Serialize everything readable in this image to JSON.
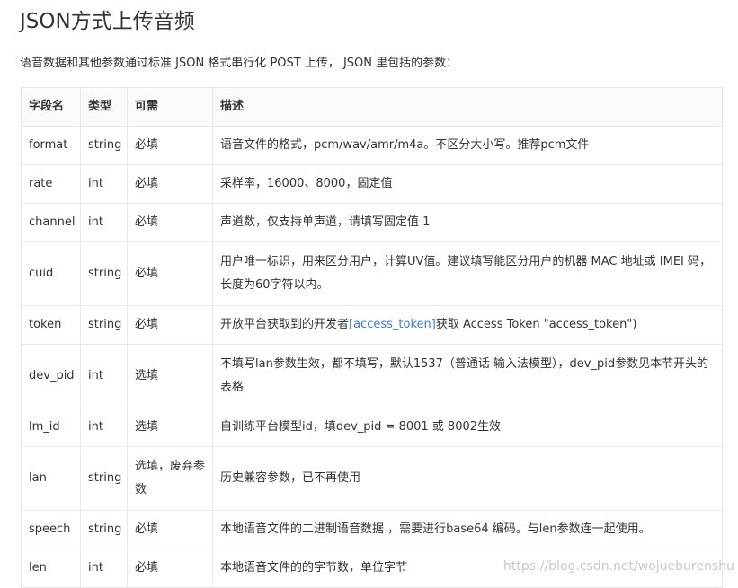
{
  "title": "JSON方式上传音频",
  "intro": "语音数据和其他参数通过标准 JSON 格式串行化 POST 上传， JSON 里包括的参数：",
  "table": {
    "headers": [
      "字段名",
      "类型",
      "可需",
      "描述"
    ],
    "rows": [
      {
        "name": "format",
        "type": "string",
        "required": "必填",
        "desc": "语音文件的格式，pcm/wav/amr/m4a。不区分大小写。推荐pcm文件"
      },
      {
        "name": "rate",
        "type": "int",
        "required": "必填",
        "desc": "采样率，16000、8000，固定值"
      },
      {
        "name": "channel",
        "type": "int",
        "required": "必填",
        "desc": "声道数，仅支持单声道，请填写固定值 1"
      },
      {
        "name": "cuid",
        "type": "string",
        "required": "必填",
        "desc": "用户唯一标识，用来区分用户，计算UV值。建议填写能区分用户的机器 MAC 地址或 IMEI 码，长度为60字符以内。"
      },
      {
        "name": "token",
        "type": "string",
        "required": "必填",
        "desc_pre": "开放平台获取到的开发者",
        "desc_link": "[access_token]",
        "desc_post": "获取 Access Token \"access_token\")"
      },
      {
        "name": "dev_pid",
        "type": "int",
        "required": "选填",
        "desc": "不填写lan参数生效，都不填写，默认1537（普通话 输入法模型），dev_pid参数见本节开头的表格"
      },
      {
        "name": "lm_id",
        "type": "int",
        "required": "选填",
        "desc": "自训练平台模型id，填dev_pid = 8001 或 8002生效"
      },
      {
        "name": "lan",
        "type": "string",
        "required": "选填，废弃参数",
        "desc": "历史兼容参数，已不再使用"
      },
      {
        "name": "speech",
        "type": "string",
        "required": "必填",
        "desc": "本地语音文件的二进制语音数据 ，需要进行base64 编码。与len参数连一起使用。"
      },
      {
        "name": "len",
        "type": "int",
        "required": "必填",
        "desc": "本地语音文件的的字节数，单位字节"
      }
    ]
  },
  "watermark": "https://blog.csdn.net/wojueburenshu",
  "colors": {
    "link": "#3b7ddd",
    "border": "#e8e8e8",
    "header_bg": "#fafafa"
  }
}
